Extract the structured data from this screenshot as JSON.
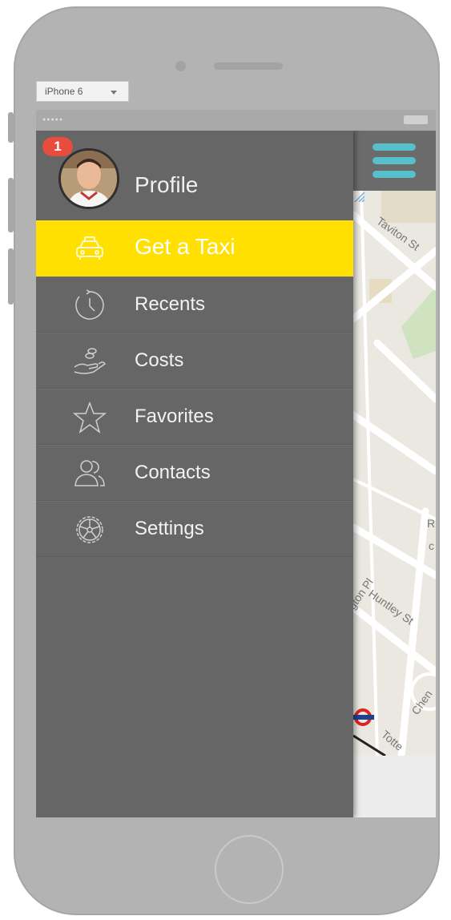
{
  "device_selector": {
    "value": "iPhone 6"
  },
  "profile": {
    "label": "Profile",
    "notification_count": "1"
  },
  "menu": {
    "items": [
      {
        "label": "Get a Taxi",
        "icon": "taxi-icon",
        "active": true
      },
      {
        "label": "Recents",
        "icon": "history-icon"
      },
      {
        "label": "Costs",
        "icon": "hand-coins-icon"
      },
      {
        "label": "Favorites",
        "icon": "star-icon"
      },
      {
        "label": "Contacts",
        "icon": "contacts-icon"
      },
      {
        "label": "Settings",
        "icon": "gear-icon"
      }
    ]
  },
  "map": {
    "streets": [
      "Taviton St",
      "ngton Pl",
      "Huntley St",
      "Chen",
      "Totte",
      "R",
      "c"
    ]
  },
  "colors": {
    "active": "#ffe000",
    "drawer": "#666666",
    "hamburger": "#56c0cc",
    "badge": "#e74c3c"
  }
}
